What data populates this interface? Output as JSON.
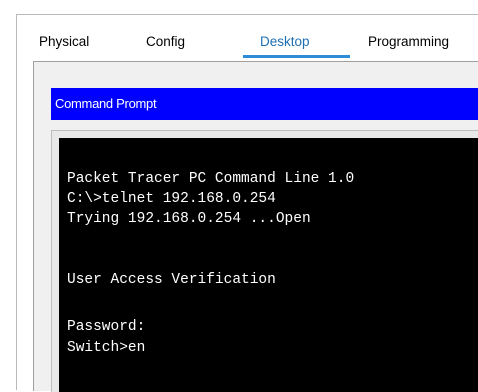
{
  "tabs": [
    {
      "label": "Physical",
      "active": false
    },
    {
      "label": "Config",
      "active": false
    },
    {
      "label": "Desktop",
      "active": true
    },
    {
      "label": "Programming",
      "active": false
    }
  ],
  "window_title": "Command Prompt",
  "terminal": {
    "lines": [
      "Packet Tracer PC Command Line 1.0",
      "C:\\>telnet 192.168.0.254",
      "Trying 192.168.0.254 ...Open",
      "",
      "",
      "User Access Verification",
      "",
      "Password:",
      "Switch>en"
    ]
  },
  "colors": {
    "title_bar": "#0000FE",
    "active_tab": "#1F6FB4",
    "tab_underline": "#2E8BD6",
    "terminal_bg": "#000000",
    "terminal_fg": "#FFFFFF"
  }
}
